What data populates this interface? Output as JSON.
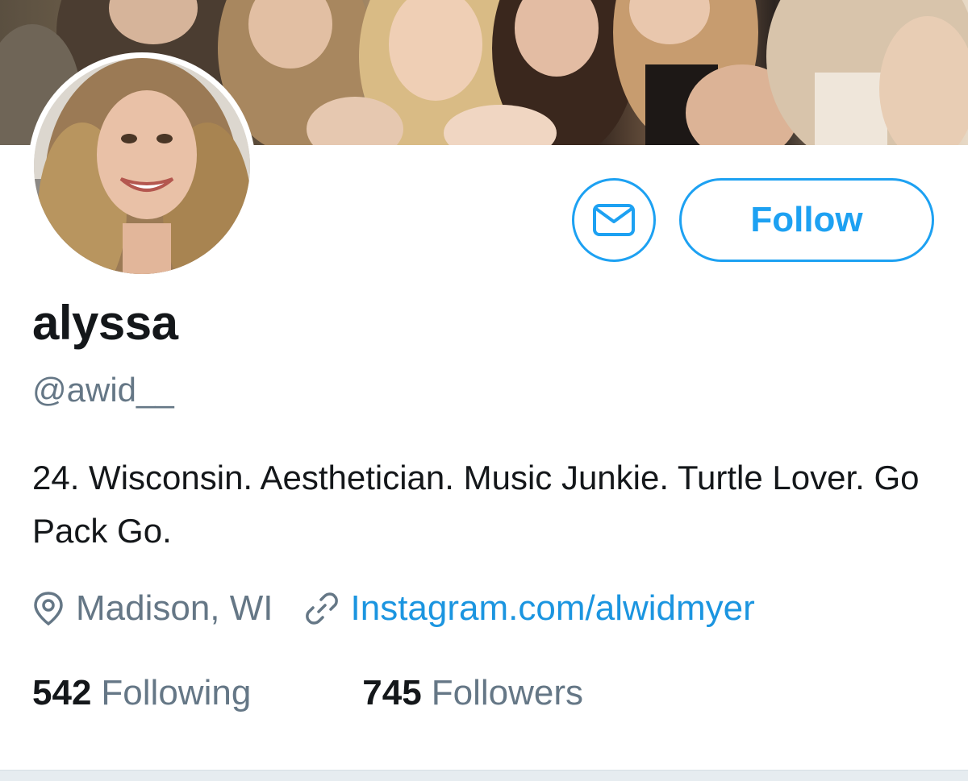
{
  "profile": {
    "display_name": "alyssa",
    "handle": "@awid__",
    "bio": "24. Wisconsin. Aesthetician. Music Junkie. Turtle Lover. Go Pack Go.",
    "location": "Madison, WI",
    "website": "Instagram.com/alwidmyer"
  },
  "actions": {
    "follow_label": "Follow"
  },
  "stats": {
    "following_count": "542",
    "following_label": "Following",
    "followers_count": "745",
    "followers_label": "Followers"
  },
  "icons": {
    "message": "envelope-icon",
    "location": "map-pin-icon",
    "link": "link-icon"
  },
  "colors": {
    "accent": "#1da1f2",
    "link": "#1b95e0",
    "secondary_text": "#657786",
    "primary_text": "#14171a"
  }
}
